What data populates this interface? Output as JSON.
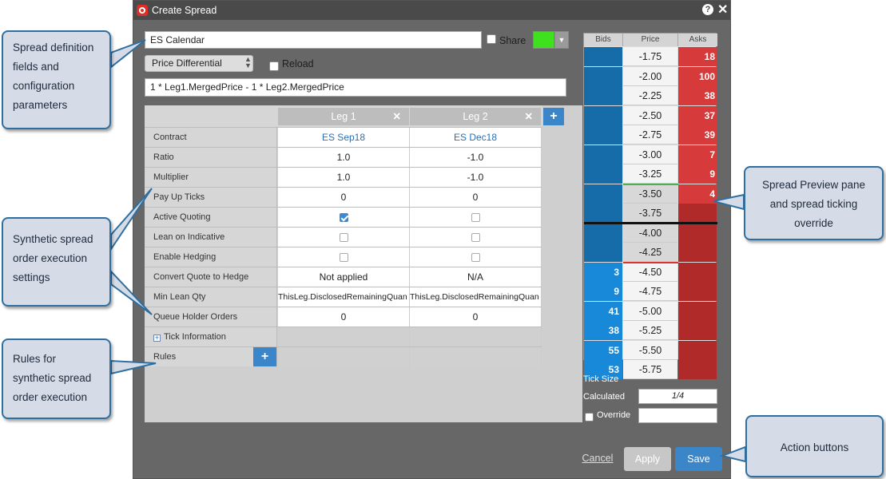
{
  "window": {
    "title": "Create Spread"
  },
  "form": {
    "name": "ES Calendar",
    "share_label": "Share",
    "swatch_color": "#3fe01e",
    "type": "Price Differential",
    "reload_label": "Reload",
    "formula": "1 * Leg1.MergedPrice - 1 * Leg2.MergedPrice"
  },
  "grid": {
    "legs": [
      "Leg 1",
      "Leg 2"
    ],
    "rows": {
      "contract": {
        "label": "Contract",
        "leg1": "ES Sep18",
        "leg2": "ES Dec18"
      },
      "ratio": {
        "label": "Ratio",
        "leg1": "1.0",
        "leg2": "-1.0"
      },
      "multiplier": {
        "label": "Multiplier",
        "leg1": "1.0",
        "leg2": "-1.0"
      },
      "payup": {
        "label": "Pay Up Ticks",
        "leg1": "0",
        "leg2": "0"
      },
      "active": {
        "label": "Active Quoting",
        "leg1": true,
        "leg2": false
      },
      "lean": {
        "label": "Lean on Indicative",
        "leg1": false,
        "leg2": false
      },
      "hedging": {
        "label": "Enable Hedging",
        "leg1": false,
        "leg2": false
      },
      "convert": {
        "label": "Convert Quote to Hedge",
        "leg1": "Not applied",
        "leg2": "N/A"
      },
      "minlean": {
        "label": "Min Lean Qty",
        "leg1": "ThisLeg.DisclosedRemainingQuan",
        "leg2": "ThisLeg.DisclosedRemainingQuan"
      },
      "queue": {
        "label": "Queue Holder Orders",
        "leg1": "0",
        "leg2": "0"
      }
    },
    "tick_info_label": "Tick Information",
    "rules_label": "Rules"
  },
  "ladder": {
    "headers": {
      "bids": "Bids",
      "price": "Price",
      "asks": "Asks"
    },
    "prices": [
      "-1.75",
      "-2.00",
      "-2.25",
      "-2.50",
      "-2.75",
      "-3.00",
      "-3.25",
      "-3.50",
      "-3.75",
      "-4.00",
      "-4.25",
      "-4.50",
      "-4.75",
      "-5.00",
      "-5.25",
      "-5.50",
      "-5.75"
    ],
    "asks": [
      "18",
      "100",
      "38",
      "37",
      "39",
      "7",
      "9",
      "4",
      "",
      "",
      "",
      "",
      "",
      "",
      "",
      "",
      ""
    ],
    "bids": [
      "",
      "",
      "",
      "",
      "",
      "",
      "",
      "",
      "",
      "",
      "",
      "3",
      "9",
      "41",
      "38",
      "55",
      "53"
    ],
    "colors": {
      "bid_dark": "#156ca8",
      "bid_light": "#1888d8",
      "ask": "#d63a3a",
      "ask_dark": "#b02a2a"
    }
  },
  "tick": {
    "title": "Tick Size",
    "calculated_label": "Calculated",
    "calculated_value": "1/4",
    "override_label": "Override"
  },
  "actions": {
    "cancel": "Cancel",
    "apply": "Apply",
    "save": "Save"
  },
  "callouts": {
    "definition": "Spread definition fields and configuration parameters",
    "execution": "Synthetic spread order execution settings",
    "rules": "Rules for synthetic spread order execution",
    "preview": "Spread Preview pane and spread ticking override",
    "actions": "Action buttons"
  }
}
